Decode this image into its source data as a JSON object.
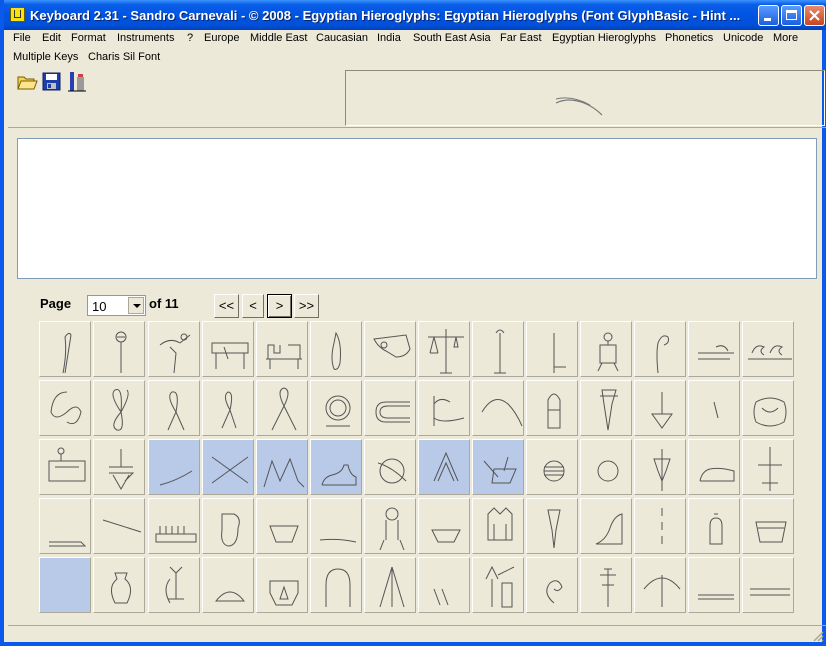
{
  "window": {
    "title": "Keyboard 2.31 - Sandro Carnevali - ©  2008 - Egyptian Hieroglyphs: Egyptian Hieroglyphs (Font GlyphBasic - Hint ..."
  },
  "menu": {
    "row1": [
      "File",
      "Edit",
      "Format",
      "Instruments",
      "?",
      "Europe",
      "Middle East",
      "Caucasian",
      "India",
      "South East Asia",
      "Far East",
      "Egyptian Hieroglyphs",
      "Phonetics",
      "Unicode",
      "More"
    ],
    "row2": [
      "Multiple Keys",
      "Charis Sil Font"
    ]
  },
  "toolbar": {
    "icons": [
      "open-folder-icon",
      "save-disk-icon",
      "font-tool-icon"
    ]
  },
  "text_area": {
    "value": ""
  },
  "pager": {
    "page_label": "Page",
    "current_page": "10",
    "of_label": "of 11",
    "first_label": "<<",
    "prev_label": "<",
    "next_label": ">",
    "last_label": ">>"
  },
  "glyph_grid": {
    "columns": 14,
    "rows": 5,
    "selected_cells": [
      30,
      31,
      32,
      33,
      35,
      36,
      56
    ],
    "selected_color": "#b9c9e8"
  }
}
